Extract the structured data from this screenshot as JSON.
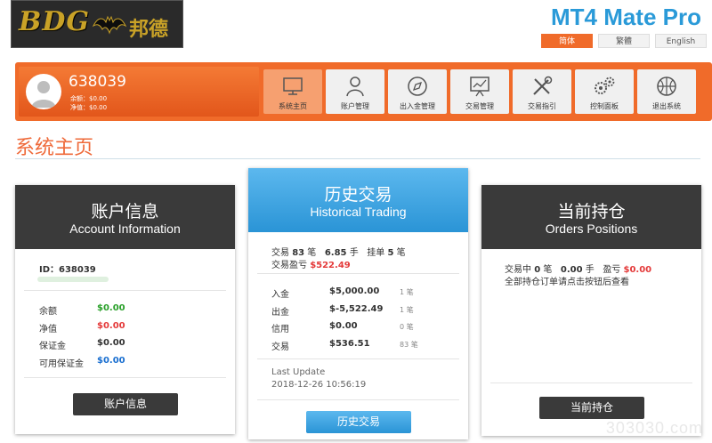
{
  "header": {
    "logo_text": "BDG",
    "logo_cn": "邦德",
    "brand": "MT4 Mate Pro",
    "languages": [
      "简体",
      "繁體",
      "English"
    ]
  },
  "account": {
    "id": "638039",
    "balance_line": "余额：$0.00",
    "equity_line": "净值：$0.00"
  },
  "nav": {
    "items": [
      "系统主页",
      "账户管理",
      "出入金管理",
      "交易管理",
      "交易指引",
      "控制面板",
      "退出系统"
    ]
  },
  "page_title": "系统主页",
  "account_info": {
    "title_cn": "账户信息",
    "title_en": "Account Information",
    "id_label": "ID：638039",
    "rows": [
      {
        "label": "余额",
        "value": "$0.00"
      },
      {
        "label": "净值",
        "value": "$0.00"
      },
      {
        "label": "保证金",
        "value": "$0.00"
      },
      {
        "label": "可用保证金",
        "value": "$0.00"
      }
    ],
    "button": "账户信息"
  },
  "history": {
    "title_cn": "历史交易",
    "title_en": "Historical Trading",
    "trades_label": "交易",
    "trades_count": "83",
    "unit_bi": "笔",
    "lots": "6.85",
    "unit_shou": "手",
    "pending_label": "挂单",
    "pending_count": "5",
    "profit_label": "交易盈亏",
    "profit_value": "$522.49",
    "rows": [
      {
        "label": "入金",
        "value": "$5,000.00",
        "count": "1 笔"
      },
      {
        "label": "出金",
        "value": "$-5,522.49",
        "count": "1 笔"
      },
      {
        "label": "信用",
        "value": "$0.00",
        "count": "0 笔"
      },
      {
        "label": "交易",
        "value": "$536.51",
        "count": "83 笔"
      }
    ],
    "last_update_label": "Last Update",
    "last_update_value": "2018-12-26 10:56:19",
    "button": "历史交易"
  },
  "positions": {
    "title_cn": "当前持仓",
    "title_en": "Orders Positions",
    "trading_label": "交易中",
    "trading_count": "0",
    "unit_bi": "笔",
    "lots": "0.00",
    "unit_shou": "手",
    "profit_label": "盈亏",
    "profit_value": "$0.00",
    "note": "全部持仓订单请点击按钮后查看",
    "button": "当前持仓"
  },
  "watermark": "303030.com",
  "colors": {
    "accent": "#f06b2a",
    "blue": "#2a94d6",
    "dark": "#3a3a3a"
  }
}
